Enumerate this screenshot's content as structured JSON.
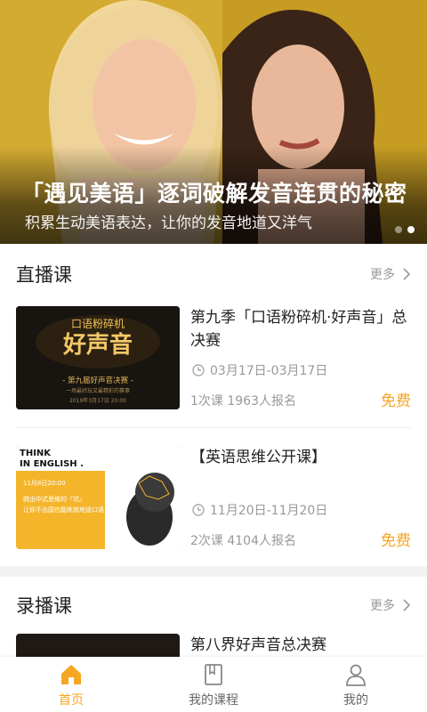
{
  "banner": {
    "title": "「遇见美语」逐词破解发音连贯的秘密",
    "subtitle": "积累生动美语表达，让你的发音地道又洋气",
    "page_count": 2,
    "active_page": 2
  },
  "live_section": {
    "title": "直播课",
    "more_label": "更多",
    "courses": [
      {
        "title": "第九季「口语粉碎机·好声音」总决赛",
        "date": "03月17日-03月17日",
        "meta": "1次课  1963人报名",
        "price": "免费",
        "thumb": {
          "logo_top": "口语粉碎机",
          "logo_main": "好声音",
          "caption": "- 第九届好声音决赛 -",
          "small": "一场最好玩又最精彩的赛事",
          "date": "2019年3月17日 20:00"
        }
      },
      {
        "title": "【英语思维公开课】",
        "date": "11月20日-11月20日",
        "meta": "2次课  4104人报名",
        "price": "免费",
        "thumb": {
          "line1": "THINK",
          "line2": "IN ENGLISH .",
          "time": "11月8日20:00",
          "text1": "跳出中式思维的「坑」",
          "text2": "让你不出国也能练就地道口语"
        }
      }
    ]
  },
  "record_section": {
    "title": "录播课",
    "more_label": "更多",
    "courses": [
      {
        "title": "第八界好声音总决赛"
      }
    ]
  },
  "tabbar": {
    "items": [
      {
        "label": "首页",
        "icon": "home-icon",
        "active": true
      },
      {
        "label": "我的课程",
        "icon": "book-icon",
        "active": false
      },
      {
        "label": "我的",
        "icon": "user-icon",
        "active": false
      }
    ]
  },
  "colors": {
    "accent": "#f5a623",
    "banner_yellow": "#d8b138",
    "muted": "#999999"
  }
}
